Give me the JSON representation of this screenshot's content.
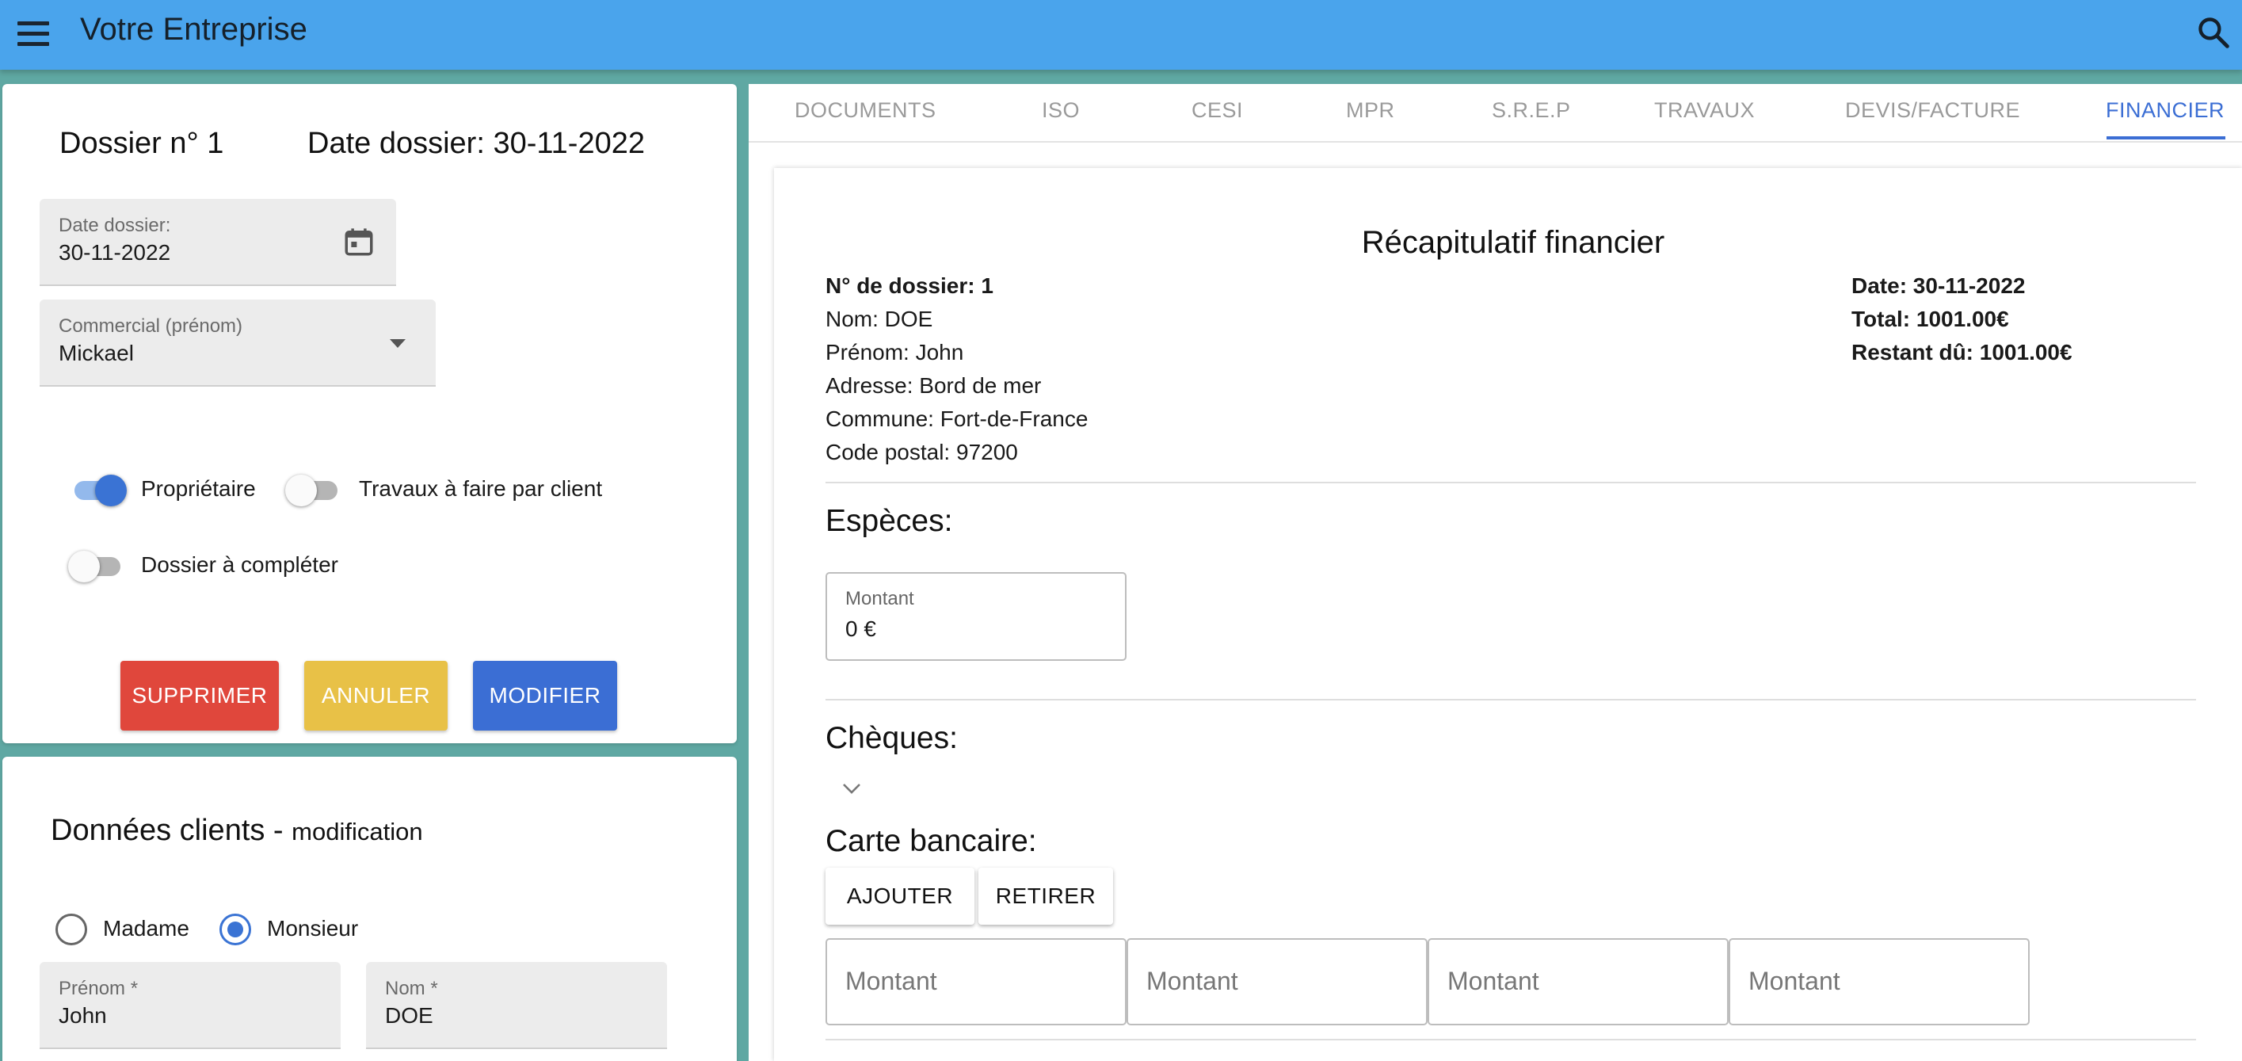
{
  "header": {
    "title": "Votre Entreprise"
  },
  "dossier": {
    "number_label": "Dossier n° 1",
    "date_label": "Date dossier: 30-11-2022",
    "date_field": {
      "label": "Date dossier:",
      "value": "30-11-2022"
    },
    "commercial_field": {
      "label": "Commercial (prénom)",
      "value": "Mickael"
    },
    "toggles": [
      {
        "label": "Propriétaire",
        "on": true
      },
      {
        "label": "Travaux à faire par client",
        "on": false
      },
      {
        "label": "Dossier à compléter",
        "on": false
      }
    ],
    "buttons": {
      "delete": "SUPPRIMER",
      "cancel": "ANNULER",
      "modify": "MODIFIER"
    }
  },
  "clients": {
    "title": "Données clients -",
    "subtitle": "modification",
    "civility": [
      {
        "label": "Madame",
        "selected": false
      },
      {
        "label": "Monsieur",
        "selected": true
      }
    ],
    "prenom_field": {
      "label": "Prénom *",
      "value": "John"
    },
    "nom_field": {
      "label": "Nom *",
      "value": "DOE"
    }
  },
  "tabs": [
    "DOCUMENTS",
    "ISO",
    "CESI",
    "MPR",
    "S.R.E.P",
    "TRAVAUX",
    "DEVIS/FACTURE",
    "FINANCIER"
  ],
  "active_tab": "FINANCIER",
  "recap": {
    "title": "Récapitulatif financier",
    "dossier_no": "N° de dossier: 1",
    "nom": "Nom: DOE",
    "prenom": "Prénom: John",
    "adresse": "Adresse: Bord de mer",
    "commune": "Commune: Fort-de-France",
    "code_postal": "Code postal: 97200",
    "date": "Date: 30-11-2022",
    "total": "Total: 1001.00€",
    "restant": "Restant dû: 1001.00€"
  },
  "especes": {
    "title": "Espèces:",
    "field_label": "Montant",
    "field_value": "0 €"
  },
  "cheques": {
    "title": "Chèques:"
  },
  "carte": {
    "title": "Carte bancaire:",
    "add_label": "AJOUTER",
    "remove_label": "RETIRER",
    "amount_placeholders": [
      "Montant",
      "Montant",
      "Montant",
      "Montant"
    ]
  },
  "colors": {
    "appbar": "#4aa4ec",
    "accent": "#3b6ed4",
    "danger": "#e0473c",
    "warning": "#e8c147",
    "background": "#5fa8a3"
  }
}
